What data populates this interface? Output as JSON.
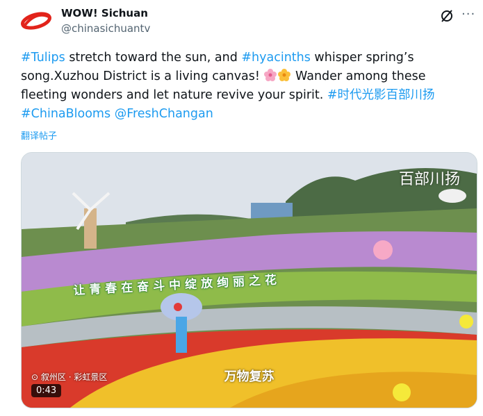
{
  "author": {
    "display_name": "WOW! Sichuan",
    "handle": "@chinasichuantv"
  },
  "icons": {
    "logo": "wow-sichuan-logo-icon",
    "grok": "grok-icon",
    "more": "more-icon",
    "location": "location-pin-icon"
  },
  "tweet": {
    "hashtag_tulips": "#Tulips",
    "text_1": " stretch toward the sun, and ",
    "hashtag_hyacinths": "#hyacinths",
    "text_2": " whisper spring’s song.Xuzhou District is a living canvas! ",
    "text_3": " Wander among these fleeting wonders and let nature revive your spirit. ",
    "hashtag_cn": "#时代光影百部川扬",
    "hashtag_blooms": "#ChinaBlooms",
    "mention": "@FreshChangan"
  },
  "translate_label": "翻译帖子",
  "video": {
    "caption": "万物复苏",
    "banner": "让青春在奋斗中绽放绚丽之花",
    "watermark": "百部川扬",
    "location": "叙州区 · 彩虹景区",
    "duration": "0:43"
  },
  "colors": {
    "link": "#1d9bf0",
    "text": "#0f1419",
    "secondary": "#536471",
    "logo_red": "#e2231a"
  }
}
